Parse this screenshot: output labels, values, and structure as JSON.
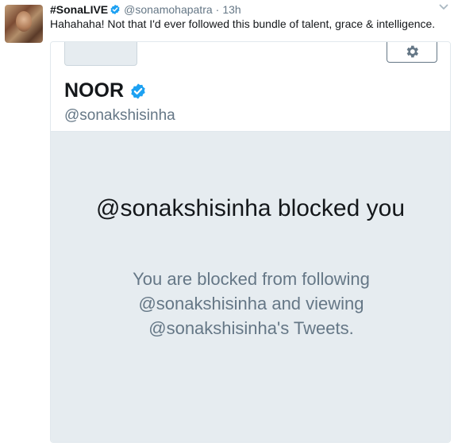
{
  "tweet": {
    "display_name": "#SonaLIVE",
    "handle": "@sonamohapatra",
    "separator": "·",
    "time": "13h",
    "text": "Hahahaha! Not that I'd ever followed this bundle of talent, grace & intelligence."
  },
  "card": {
    "profile_name": "NOOR",
    "profile_handle": "@sonakshisinha",
    "blocked_title": "@sonakshisinha blocked you",
    "blocked_description": "You are blocked from following @sonakshisinha and viewing @sonakshisinha's Tweets."
  },
  "icons": {
    "verified": "verified-badge-icon",
    "settings": "gear-icon",
    "menu": "chevron-down-icon"
  },
  "colors": {
    "verified_blue": "#1da1f2",
    "secondary_text": "#657786",
    "card_body_bg": "#e6ecf0"
  }
}
